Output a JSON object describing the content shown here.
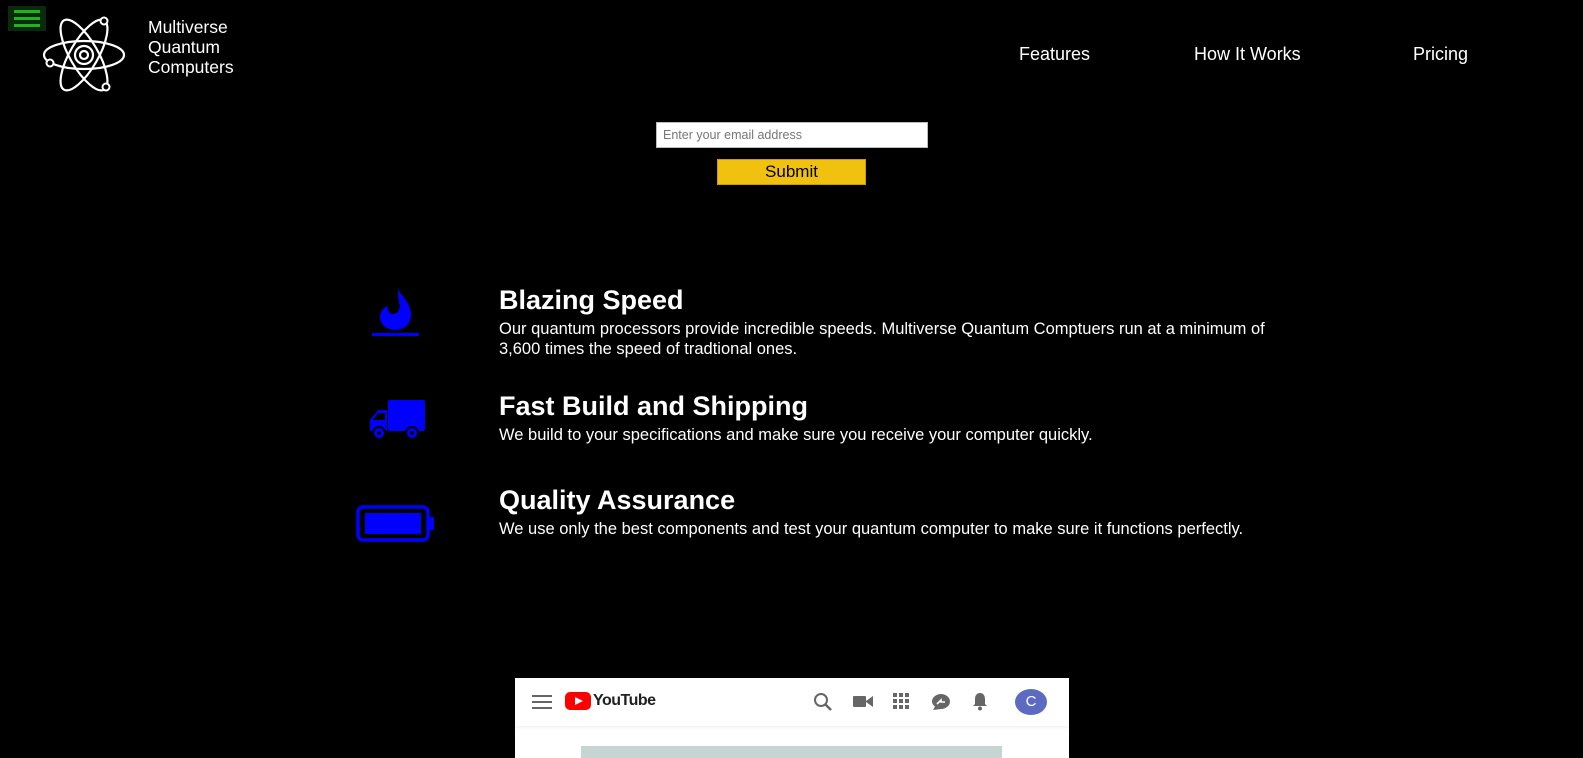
{
  "header": {
    "brand_lines": [
      "Multiverse",
      "Quantum",
      "Computers"
    ],
    "nav": [
      {
        "label": "Features"
      },
      {
        "label": "How It Works"
      },
      {
        "label": "Pricing"
      }
    ]
  },
  "signup": {
    "email_placeholder": "Enter your email address",
    "submit_label": "Submit",
    "submit_color": "#f0c20f"
  },
  "features": [
    {
      "icon": "fire-icon",
      "title": "Blazing Speed",
      "description": "Our quantum processors provide incredible speeds. Multiverse Quantum Comptuers run at a minimum of 3,600 times the speed of tradtional ones."
    },
    {
      "icon": "truck-icon",
      "title": "Fast Build and Shipping",
      "description": "We build to your specifications and make sure you receive your computer quickly."
    },
    {
      "icon": "battery-icon",
      "title": "Quality Assurance",
      "description": "We use only the best components and test your quantum computer to make sure it functions perfectly."
    }
  ],
  "video": {
    "brand": "YouTube",
    "avatar_initial": "C"
  },
  "colors": {
    "background": "#000000",
    "icon_blue": "#0000ff",
    "menu_green": "#1fb41f",
    "youtube_red": "#ff0000",
    "avatar": "#5c6bc0"
  }
}
